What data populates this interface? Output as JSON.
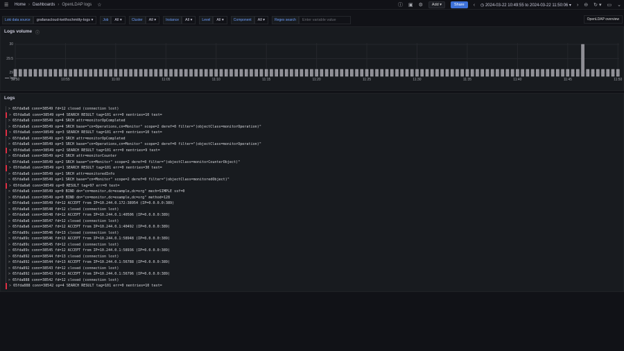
{
  "topbar": {
    "breadcrumbs": [
      "Home",
      "Dashboards",
      "OpenLDAP logs"
    ],
    "add_label": "Add",
    "share_label": "Share",
    "time_range": "2024-03-22 10:49:55 to 2024-03-22 11:50:06"
  },
  "variables": [
    {
      "label": "Loki data source",
      "value": "grafanacloud-keithschmitty-logs"
    },
    {
      "label": "Job",
      "value": "All"
    },
    {
      "label": "Cluster",
      "value": "All"
    },
    {
      "label": "Instance",
      "value": "All"
    },
    {
      "label": "Level",
      "value": "All"
    },
    {
      "label": "Component",
      "value": "All"
    }
  ],
  "regex": {
    "label": "Regex search",
    "placeholder": "Enter variable value"
  },
  "overview_link": "OpenLDAP overview",
  "volume_panel": {
    "title": "Logs volume"
  },
  "chart_data": {
    "type": "bar",
    "title": "Logs volume",
    "ylim": [
      29,
      30
    ],
    "yticks": [
      "29",
      "29.5",
      "30"
    ],
    "xticks": [
      "10:50",
      "10:55",
      "11:00",
      "11:05",
      "11:10",
      "11:15",
      "11:20",
      "11:25",
      "11:30",
      "11:35",
      "11:40",
      "11:45",
      "11:50"
    ],
    "start": "10:50",
    "interval_seconds": 30,
    "series": [
      {
        "name": "logs",
        "color": "#8e8e95",
        "values": [
          29,
          29,
          29,
          29,
          29,
          29,
          29,
          29,
          29,
          29,
          29,
          29,
          29,
          29,
          29,
          29,
          29,
          29,
          29,
          29,
          29,
          29,
          29,
          29,
          29,
          29,
          29,
          29,
          29,
          29,
          29,
          29,
          29,
          29,
          29,
          29,
          29,
          29,
          29,
          29,
          29,
          29,
          29,
          29,
          29,
          29,
          29,
          29,
          29,
          29,
          29,
          29,
          29,
          29,
          29,
          29,
          29,
          29,
          29,
          29,
          29,
          29,
          29,
          29,
          29,
          29,
          29,
          29,
          29,
          29,
          29,
          29,
          29,
          29,
          29,
          29,
          29,
          29,
          29,
          29,
          29,
          29,
          29,
          29,
          29,
          29,
          29,
          29,
          29,
          29,
          29,
          29,
          29,
          29,
          29,
          29,
          29,
          29,
          29,
          29,
          29,
          29,
          29,
          29,
          29,
          29,
          29,
          29,
          29,
          29,
          29,
          29,
          29,
          30,
          29,
          29,
          29,
          29,
          29,
          29,
          29
        ]
      }
    ],
    "legend": "bottom-left"
  },
  "logs_panel": {
    "title": "Logs",
    "lines": [
      {
        "text": "65fda8a6 conn=38549 fd=12 closed (connection lost)",
        "err": false
      },
      {
        "text": "65fda8a6 conn=38549 op=4 SEARCH RESULT tag=101 err=0 nentries=10 text=",
        "err": true
      },
      {
        "text": "65fda8a6 conn=38549 op=4 SRCH attr=monitorOpCompleted",
        "err": false
      },
      {
        "text": "65fda8a6 conn=38549 op=4 SRCH base=\"cn=Operations,cn=Monitor\" scope=2 deref=0 filter=\"(objectClass=monitorOperation)\"",
        "err": false
      },
      {
        "text": "65fda8a6 conn=38549 op=3 SEARCH RESULT tag=101 err=0 nentries=10 text=",
        "err": true
      },
      {
        "text": "65fda8a6 conn=38549 op=3 SRCH attr=monitorOpCompleted",
        "err": false
      },
      {
        "text": "65fda8a6 conn=38549 op=3 SRCH base=\"cn=Operations,cn=Monitor\" scope=2 deref=0 filter=\"(objectClass=monitorOperation)\"",
        "err": false
      },
      {
        "text": "65fda8a6 conn=38549 op=2 SEARCH RESULT tag=101 err=0 nentries=9 text=",
        "err": true
      },
      {
        "text": "65fda8a6 conn=38549 op=2 SRCH attr=monitorCounter",
        "err": false
      },
      {
        "text": "65fda8a6 conn=38549 op=2 SRCH base=\"cn=Monitor\" scope=2 deref=0 filter=\"(objectClass=monitorCounterObject)\"",
        "err": false
      },
      {
        "text": "65fda8a6 conn=38549 op=1 SEARCH RESULT tag=101 err=0 nentries=30 text=",
        "err": true
      },
      {
        "text": "65fda8a6 conn=38549 op=1 SRCH attr=monitoredInfo",
        "err": false
      },
      {
        "text": "65fda8a6 conn=38549 op=1 SRCH base=\"cn=Monitor\" scope=2 deref=0 filter=\"(objectClass=monitoredObject)\"",
        "err": false
      },
      {
        "text": "65fda8a6 conn=38549 op=0 RESULT tag=97 err=0 text=",
        "err": true
      },
      {
        "text": "65fda8a6 conn=38549 op=0 BIND dn=\"cn=monitor,dc=example,dc=org\" mech=SIMPLE ssf=0",
        "err": false
      },
      {
        "text": "65fda8a6 conn=38549 op=0 BIND dn=\"cn=monitor,dc=example,dc=org\" method=128",
        "err": false
      },
      {
        "text": "65fda8a6 conn=38549 fd=12 ACCEPT from IP=10.244.0.172:38954 (IP=0.0.0.0:389)",
        "err": false
      },
      {
        "text": "65fda8a6 conn=38548 fd=12 closed (connection lost)",
        "err": false
      },
      {
        "text": "65fda8a6 conn=38548 fd=12 ACCEPT from IP=10.244.0.1:40506 (IP=0.0.0.0:389)",
        "err": false
      },
      {
        "text": "65fda8a6 conn=38547 fd=12 closed (connection lost)",
        "err": false
      },
      {
        "text": "65fda8a6 conn=38547 fd=12 ACCEPT from IP=10.244.0.1:40492 (IP=0.0.0.0:389)",
        "err": false
      },
      {
        "text": "65fda89c conn=38546 fd=13 closed (connection lost)",
        "err": false
      },
      {
        "text": "65fda89c conn=38546 fd=13 ACCEPT from IP=10.244.0.1:58948 (IP=0.0.0.0:389)",
        "err": false
      },
      {
        "text": "65fda89c conn=38545 fd=12 closed (connection lost)",
        "err": false
      },
      {
        "text": "65fda89c conn=38545 fd=12 ACCEPT from IP=10.244.0.1:58936 (IP=0.0.0.0:389)",
        "err": false
      },
      {
        "text": "65fda892 conn=38544 fd=13 closed (connection lost)",
        "err": false
      },
      {
        "text": "65fda892 conn=38544 fd=13 ACCEPT from IP=10.244.0.1:56788 (IP=0.0.0.0:389)",
        "err": false
      },
      {
        "text": "65fda892 conn=38543 fd=12 closed (connection lost)",
        "err": false
      },
      {
        "text": "65fda892 conn=38543 fd=12 ACCEPT from IP=10.244.0.1:56796 (IP=0.0.0.0:389)",
        "err": false
      },
      {
        "text": "65fda888 conn=38542 fd=12 closed (connection lost)",
        "err": false
      },
      {
        "text": "65fda888 conn=38542 op=4 SEARCH RESULT tag=101 err=0 nentries=10 text=",
        "err": true
      }
    ]
  }
}
